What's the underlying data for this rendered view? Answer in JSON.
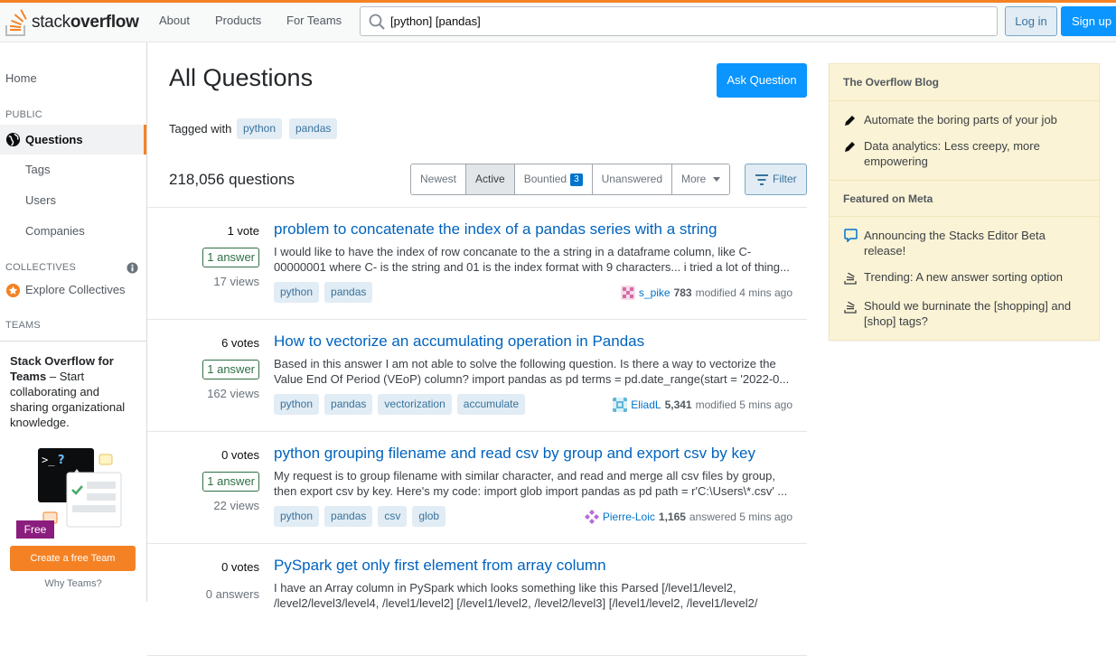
{
  "header": {
    "logo_text_light": "stack",
    "logo_text_bold": "overflow",
    "nav": [
      "About",
      "Products",
      "For Teams"
    ],
    "search_value": "[python] [pandas]",
    "login_label": "Log in",
    "signup_label": "Sign up"
  },
  "leftnav": {
    "home": "Home",
    "public_label": "PUBLIC",
    "questions": "Questions",
    "tags": "Tags",
    "users": "Users",
    "companies": "Companies",
    "collectives_label": "COLLECTIVES",
    "explore_collectives": "Explore Collectives",
    "teams_label": "TEAMS",
    "teams_title": "Stack Overflow for Teams",
    "teams_desc": " – Start collaborating and sharing organizational knowledge.",
    "free_badge": "Free",
    "create_team": "Create a free Team",
    "why_teams": "Why Teams?"
  },
  "main": {
    "title": "All Questions",
    "ask_label": "Ask Question",
    "tagged_with": "Tagged with",
    "tags": [
      "python",
      "pandas"
    ],
    "count": "218,056 questions",
    "filters": [
      "Newest",
      "Active",
      "Bountied",
      "Unanswered",
      "More"
    ],
    "bountied_count": "3",
    "filter_label": "Filter"
  },
  "questions": [
    {
      "votes": "1 vote",
      "answers": "1 answer",
      "views": "17 views",
      "title": "problem to concatenate the index of a pandas series with a string",
      "excerpt": "I would like to have the index of row concanate to the a string in a dataframe column, like C-00000001 where C- is the string and 01 is the index format with 9 characters... i tried a lot of thing...",
      "tags": [
        "python",
        "pandas"
      ],
      "user": "s_pike",
      "rep": "783",
      "action": "modified 4 mins ago",
      "avatar_color": "#d46ba6"
    },
    {
      "votes": "6 votes",
      "answers": "1 answer",
      "views": "162 views",
      "title": "How to vectorize an accumulating operation in Pandas",
      "excerpt": "Based in this answer I am not able to solve the following question. Is there a way to vectorize the Value End Of Period (VEoP) column? import pandas as pd terms = pd.date_range(start = '2022-0...",
      "tags": [
        "python",
        "pandas",
        "vectorization",
        "accumulate"
      ],
      "user": "EliadL",
      "rep": "5,341",
      "action": "modified 5 mins ago",
      "avatar_color": "#5fb7d9"
    },
    {
      "votes": "0 votes",
      "answers": "1 answer",
      "views": "22 views",
      "title": "python grouping filename and read csv by group and export csv by key",
      "excerpt": "My request is to group filename with similar character, and read and merge all csv files by group, then export csv by key. Here's my code: import glob import pandas as pd path = r'C:\\Users\\*.csv' ...",
      "tags": [
        "python",
        "pandas",
        "csv",
        "glob"
      ],
      "user": "Pierre-Loic",
      "rep": "1,165",
      "action": "answered 5 mins ago",
      "avatar_color": "#b76bd4"
    },
    {
      "votes": "0 votes",
      "answers": "0 answers",
      "views": "",
      "title": "PySpark get only first element from array column",
      "excerpt": "I have an Array column in PySpark which looks something like this Parsed [/level1/level2, /level2/level3/level4, /level1/level2] [/level1/level2, /level2/level3] [/level1/level2, /level1/level2/",
      "tags": [],
      "user": "",
      "rep": "",
      "action": "",
      "avatar_color": ""
    }
  ],
  "sidebar": {
    "blog_title": "The Overflow Blog",
    "blog_items": [
      "Automate the boring parts of your job",
      "Data analytics: Less creepy, more empowering"
    ],
    "meta_title": "Featured on Meta",
    "meta_items": [
      "Announcing the Stacks Editor Beta release!",
      "Trending: A new answer sorting option",
      "Should we burninate the [shopping] and [shop] tags?"
    ]
  }
}
